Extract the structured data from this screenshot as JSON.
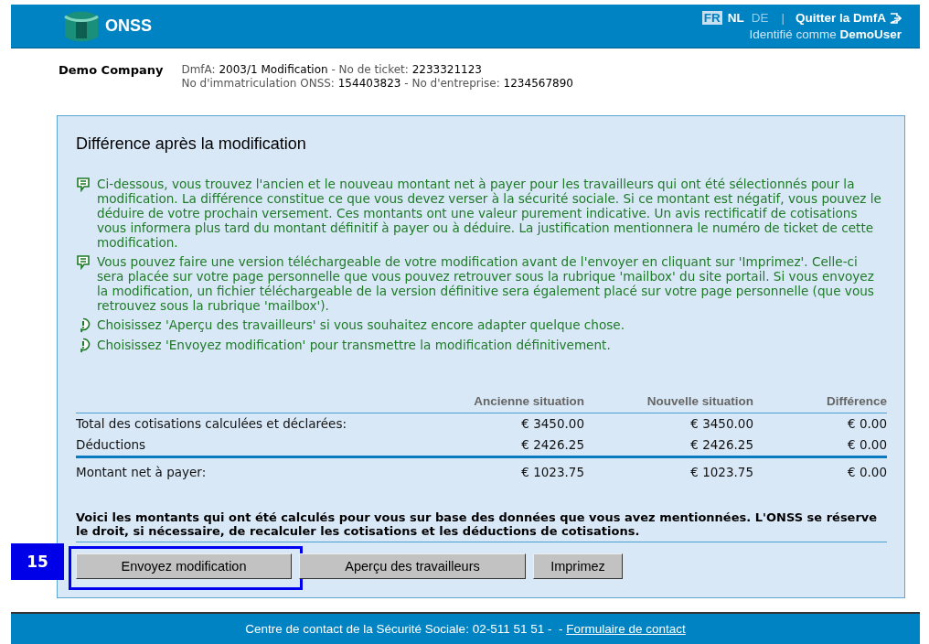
{
  "header": {
    "logo_text": "ONSS",
    "languages": [
      {
        "label": "FR",
        "selected": true,
        "disabled": false
      },
      {
        "label": "NL",
        "selected": false,
        "disabled": false
      },
      {
        "label": "DE",
        "selected": false,
        "disabled": true
      }
    ],
    "separator": "|",
    "quit_label": "Quitter la DmfA",
    "identified_label": "Identifié comme",
    "user": "DemoUser"
  },
  "company": "Demo Company",
  "ticket_lines": [
    [
      {
        "kind": "label",
        "text": "DmfA: "
      },
      {
        "kind": "value",
        "text": "2003/1 Modification"
      },
      {
        "kind": "label",
        "text": " - No de ticket: "
      },
      {
        "kind": "value",
        "text": "2233321123"
      }
    ],
    [
      {
        "kind": "label",
        "text": "No d'immatriculation ONSS: "
      },
      {
        "kind": "value",
        "text": "154403823"
      },
      {
        "kind": "label",
        "text": " - No d'entreprise: "
      },
      {
        "kind": "value",
        "text": "1234567890"
      }
    ]
  ],
  "panel": {
    "title": "Différence après la modification",
    "notes": [
      {
        "kind": "info",
        "text": "Ci-dessous, vous trouvez l'ancien et le nouveau montant net à payer pour les travailleurs qui ont été sélectionnés pour la modification. La différence constitue ce que vous devez verser à la sécurité sociale. Si ce montant est négatif, vous pouvez le déduire de votre prochain versement. Ces montants ont une valeur purement indicative. Un avis rectificatif de cotisations vous informera plus tard du montant définitif à payer ou à déduire. La justification mentionnera le numéro de ticket de cette modification."
      },
      {
        "kind": "info",
        "text": "Vous pouvez faire une version téléchargeable de votre modification avant de l'envoyer en cliquant sur 'Imprimez'. Celle-ci sera placée sur votre page personnelle que vous pouvez retrouver sous la rubrique 'mailbox' du site portail. Si vous envoyez la modification, un fichier téléchargeable de la version définitive sera également placé sur votre page personnelle (que vous retrouvez sous la rubrique 'mailbox')."
      },
      {
        "kind": "warning",
        "text": "Choisissez 'Aperçu des travailleurs' si vous souhaitez encore adapter quelque chose."
      },
      {
        "kind": "warning",
        "text": "Choisissez 'Envoyez modification' pour transmettre la modification définitivement."
      }
    ],
    "table": {
      "columns": [
        "Ancienne situation",
        "Nouvelle situation",
        "Différence"
      ],
      "rows": [
        {
          "kind": "normal",
          "label": "Total des cotisations calculées et déclarées:",
          "values": [
            "€ 3450.00",
            "€ 3450.00",
            "€ 0.00"
          ]
        },
        {
          "kind": "normal",
          "label": "Déductions",
          "values": [
            "€ 2426.25",
            "€ 2426.25",
            "€ 0.00"
          ]
        },
        {
          "kind": "total",
          "label": "Montant net à payer:",
          "values": [
            "€ 1023.75",
            "€ 1023.75",
            "€ 0.00"
          ]
        }
      ]
    },
    "disclaimer": "Voici les montants qui ont été calculés pour vous sur base des données que vous avez mentionnées. L'ONSS se réserve le droit, si nécessaire, de recalculer les cotisations et les déductions de cotisations.",
    "buttons": [
      {
        "label": "Envoyez modification",
        "highlighted": true
      },
      {
        "label": "Aperçu des travailleurs",
        "highlighted": false
      },
      {
        "label": "Imprimez",
        "highlighted": false
      }
    ]
  },
  "callout": {
    "number": "15"
  },
  "footer": {
    "text": "Centre de contact de la Sécurité Sociale: 02-511 51 51 -  - ",
    "link": "Formulaire de contact"
  }
}
